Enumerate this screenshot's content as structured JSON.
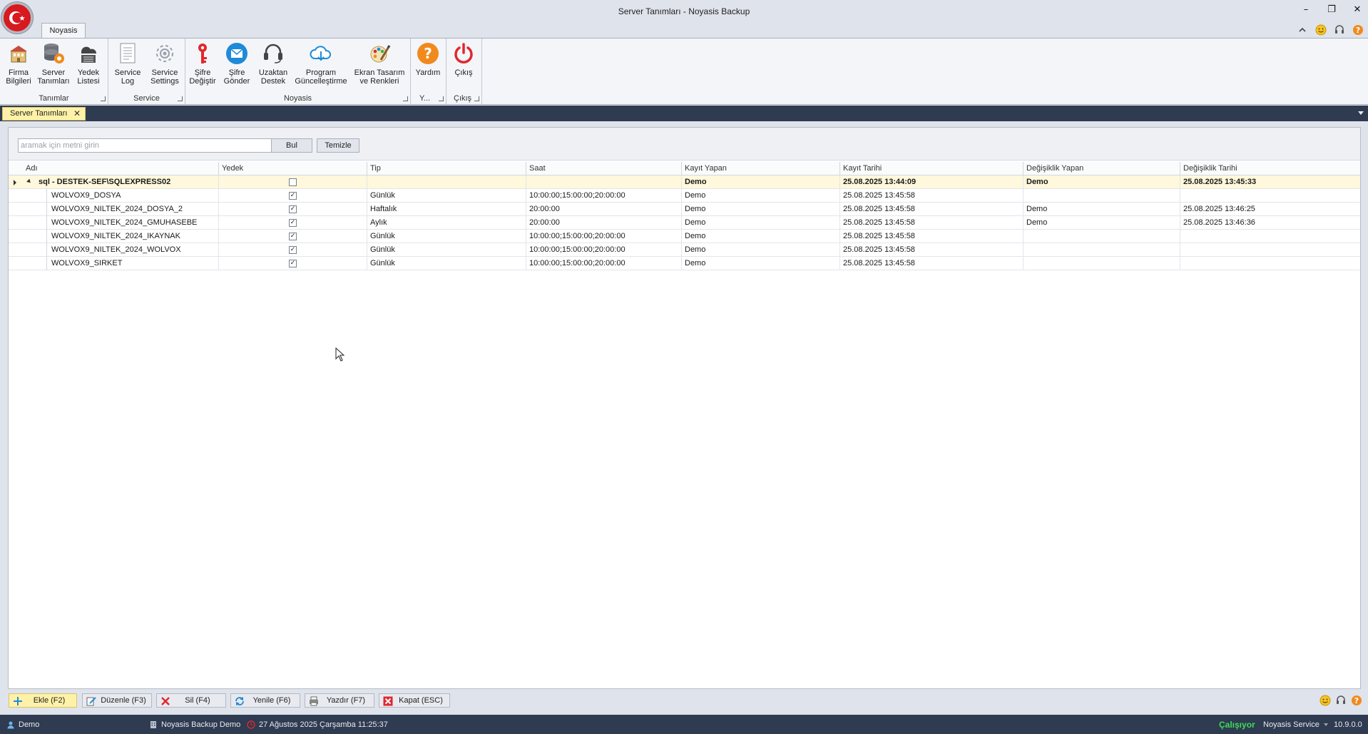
{
  "window": {
    "title": "Server Tanımları - Noyasis Backup",
    "minimize": "–",
    "restore": "❐",
    "close": "✕"
  },
  "ribbon": {
    "tab": "Noyasis",
    "groups": {
      "tanimlar": "Tanımlar",
      "service": "Service",
      "noyasis": "Noyasis",
      "yardim": "Y...",
      "cikis": "Çıkış"
    },
    "buttons": {
      "firma_bilgileri": [
        "Firma",
        "Bilgileri"
      ],
      "server_tanimlari": [
        "Server",
        "Tanımları"
      ],
      "yedek_listesi": [
        "Yedek",
        "Listesi"
      ],
      "service_log": [
        "Service",
        "Log"
      ],
      "service_settings": [
        "Service",
        "Settings"
      ],
      "sifre_degistir": [
        "Şifre",
        "Değiştir"
      ],
      "sifre_gonder": [
        "Şifre",
        "Gönder"
      ],
      "uzaktan_destek": [
        "Uzaktan",
        "Destek"
      ],
      "program_guncelle": [
        "Program",
        "Güncelleştirme"
      ],
      "ekran_tasarim": [
        "Ekran Tasarım",
        "ve Renkleri"
      ],
      "yardim": [
        "Yardım",
        ""
      ],
      "cikis": [
        "Çıkış",
        ""
      ]
    }
  },
  "doc_tab": {
    "label": "Server Tanımları",
    "close": "✕"
  },
  "search": {
    "placeholder": "aramak için metni girin",
    "find_label": "Bul",
    "clear_label": "Temizle"
  },
  "grid": {
    "columns": [
      "Adı",
      "Yedek",
      "Tip",
      "Saat",
      "Kayıt Yapan",
      "Kayıt Tarihi",
      "Değişiklik Yapan",
      "Değişiklik Tarihi"
    ],
    "parent": {
      "name": "sql - DESTEK-SEF\\SQLEXPRESS02",
      "yedek": "",
      "tip": "",
      "saat": "",
      "kayit_yapan": "Demo",
      "kayit_tarihi": "25.08.2025 13:44:09",
      "degisiklik_yapan": "Demo",
      "degisiklik_tarihi": "25.08.2025 13:45:33"
    },
    "rows": [
      {
        "name": "WOLVOX9_DOSYA",
        "yedek": "✓",
        "tip": "Günlük",
        "saat": "10:00:00;15:00:00;20:00:00",
        "kayit_yapan": "Demo",
        "kayit_tarihi": "25.08.2025 13:45:58",
        "degisiklik_yapan": "",
        "degisiklik_tarihi": ""
      },
      {
        "name": "WOLVOX9_NILTEK_2024_DOSYA_2",
        "yedek": "✓",
        "tip": "Haftalık",
        "saat": "20:00:00",
        "kayit_yapan": "Demo",
        "kayit_tarihi": "25.08.2025 13:45:58",
        "degisiklik_yapan": "Demo",
        "degisiklik_tarihi": "25.08.2025 13:46:25"
      },
      {
        "name": "WOLVOX9_NILTEK_2024_GMUHASEBE",
        "yedek": "✓",
        "tip": "Aylık",
        "saat": "20:00:00",
        "kayit_yapan": "Demo",
        "kayit_tarihi": "25.08.2025 13:45:58",
        "degisiklik_yapan": "Demo",
        "degisiklik_tarihi": "25.08.2025 13:46:36"
      },
      {
        "name": "WOLVOX9_NILTEK_2024_IKAYNAK",
        "yedek": "✓",
        "tip": "Günlük",
        "saat": "10:00:00;15:00:00;20:00:00",
        "kayit_yapan": "Demo",
        "kayit_tarihi": "25.08.2025 13:45:58",
        "degisiklik_yapan": "",
        "degisiklik_tarihi": ""
      },
      {
        "name": "WOLVOX9_NILTEK_2024_WOLVOX",
        "yedek": "✓",
        "tip": "Günlük",
        "saat": "10:00:00;15:00:00;20:00:00",
        "kayit_yapan": "Demo",
        "kayit_tarihi": "25.08.2025 13:45:58",
        "degisiklik_yapan": "",
        "degisiklik_tarihi": ""
      },
      {
        "name": "WOLVOX9_SIRKET",
        "yedek": "✓",
        "tip": "Günlük",
        "saat": "10:00:00;15:00:00;20:00:00",
        "kayit_yapan": "Demo",
        "kayit_tarihi": "25.08.2025 13:45:58",
        "degisiklik_yapan": "",
        "degisiklik_tarihi": ""
      }
    ]
  },
  "commands": {
    "ekle": "Ekle (F2)",
    "duzenle": "Düzenle (F3)",
    "sil": "Sil (F4)",
    "yenile": "Yenile (F6)",
    "yazdir": "Yazdır (F7)",
    "kapat": "Kapat (ESC)"
  },
  "status": {
    "user": "Demo",
    "company": "Noyasis Backup Demo",
    "datetime": "27 Ağustos 2025 Çarşamba 11:25:37",
    "service_state": "Çalışıyor",
    "service_name": "Noyasis Service",
    "version": "10.9.0.0"
  },
  "colors": {
    "accent_yellow": "#fff2a8",
    "status_bar": "#2e3b50",
    "service_running": "#3ddc57",
    "danger_red": "#e0282e",
    "info_blue": "#1f8ad8"
  }
}
